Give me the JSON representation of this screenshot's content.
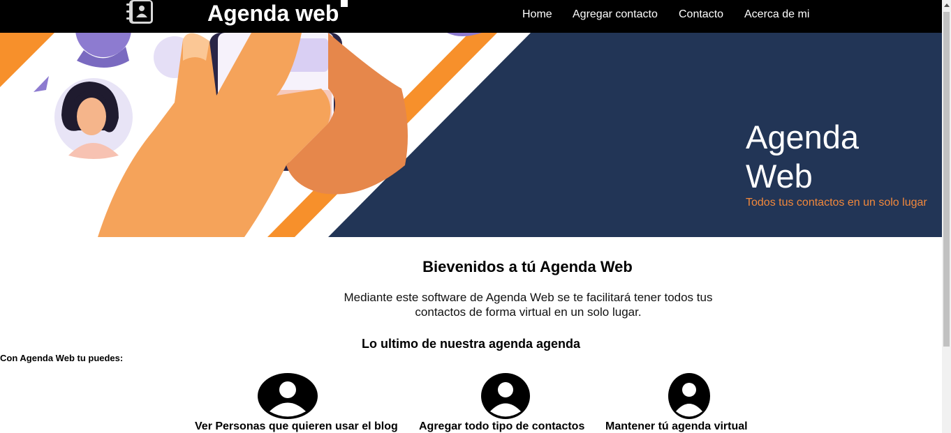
{
  "navbar": {
    "brand": "Agenda web",
    "logo_icon": "address-book-icon",
    "links": [
      "Home",
      "Agregar contacto",
      "Contacto",
      "Acerca de mi"
    ]
  },
  "hero": {
    "title": "Agenda Web",
    "subtitle": "Todos tus contactos en un solo lugar",
    "background_color": "#223556",
    "accent_color": "#f7902b",
    "subtitle_color": "#f2883b"
  },
  "welcome": {
    "title": "Bievenidos a tú Agenda Web",
    "text": "Mediante este software de Agenda Web se te facilitará tener todos tus contactos de forma virtual en un solo lugar."
  },
  "latest": {
    "title": "Lo ultimo de nuestra agenda agenda",
    "intro": "Con Agenda Web tu puedes:"
  },
  "features": [
    {
      "icon": "user-circle-icon",
      "label": "Ver Personas que quieren usar el blog"
    },
    {
      "icon": "user-circle-icon",
      "label": "Agregar todo tipo de contactos"
    },
    {
      "icon": "user-circle-icon",
      "label": "Mantener tú agenda virtual"
    }
  ]
}
